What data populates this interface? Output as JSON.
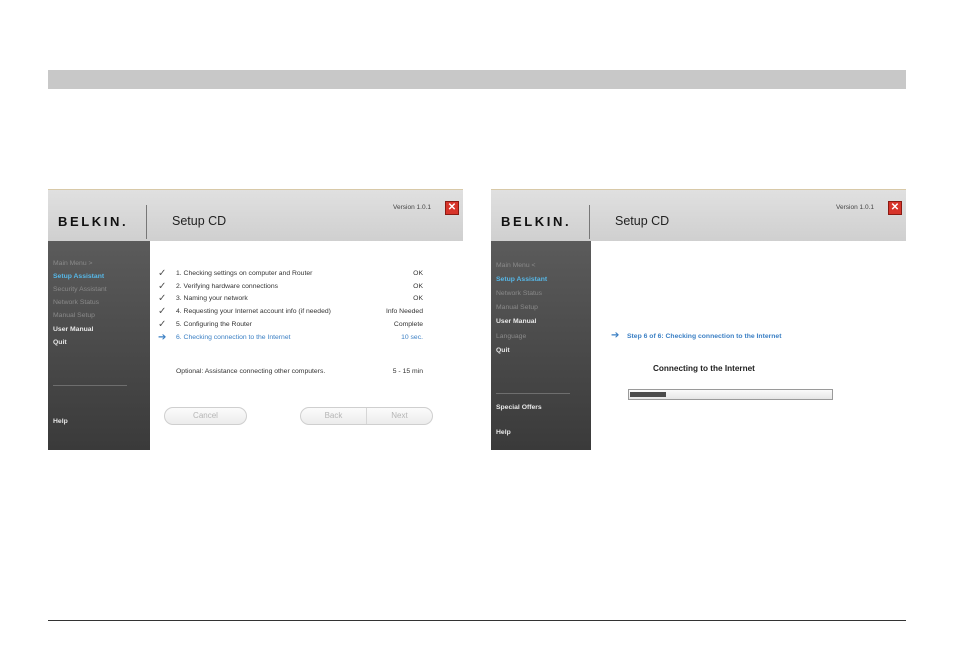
{
  "left_window": {
    "logo": "BELKIN.",
    "title": "Setup CD",
    "version": "Version 1.0.1",
    "sidebar": [
      {
        "label": "Main Menu   >",
        "state": "dim"
      },
      {
        "label": "Setup Assistant",
        "state": "active"
      },
      {
        "label": "Security Assistant",
        "state": "dim"
      },
      {
        "label": "Network Status",
        "state": "dim"
      },
      {
        "label": "Manual Setup",
        "state": "dim"
      },
      {
        "label": "User Manual",
        "state": "strong"
      },
      {
        "label": "Quit",
        "state": "strong"
      }
    ],
    "help": "Help",
    "steps": [
      {
        "label": "1. Checking settings on computer and Router",
        "status": "OK"
      },
      {
        "label": "2. Verifying hardware connections",
        "status": "OK"
      },
      {
        "label": "3. Naming your network",
        "status": "OK"
      },
      {
        "label": "4. Requesting your Internet account info (if needed)",
        "status": "Info Needed"
      },
      {
        "label": "5. Configuring the Router",
        "status": "Complete"
      },
      {
        "label": "6. Checking connection to the Internet",
        "status": "10 sec."
      }
    ],
    "optional": {
      "label": "Optional: Assistance connecting other computers.",
      "status": "5 - 15 min"
    },
    "buttons": {
      "cancel": "Cancel",
      "back": "Back",
      "next": "Next"
    }
  },
  "right_window": {
    "logo": "BELKIN.",
    "title": "Setup CD",
    "version": "Version 1.0.1",
    "sidebar": [
      {
        "label": "Main Menu   <",
        "state": "dim"
      },
      {
        "label": "Setup Assistant",
        "state": "active"
      },
      {
        "label": "Network Status",
        "state": "dim"
      },
      {
        "label": "Manual Setup",
        "state": "dim"
      },
      {
        "label": "User Manual",
        "state": "strong"
      },
      {
        "label": "Language",
        "state": "dim"
      },
      {
        "label": "Quit",
        "state": "strong"
      }
    ],
    "special_offers": "Special Offers",
    "help": "Help",
    "step_header": "Step 6 of 6: Checking connection to the Internet",
    "connecting": "Connecting to the Internet",
    "progress_fraction": 0.18
  },
  "icons": {
    "check": "check-icon",
    "arrow": "arrow-right-icon",
    "close": "close-icon"
  },
  "colors": {
    "accent_blue": "#3a7fc4",
    "sidebar_active": "#56b8e8",
    "close_red": "#d7342a"
  }
}
